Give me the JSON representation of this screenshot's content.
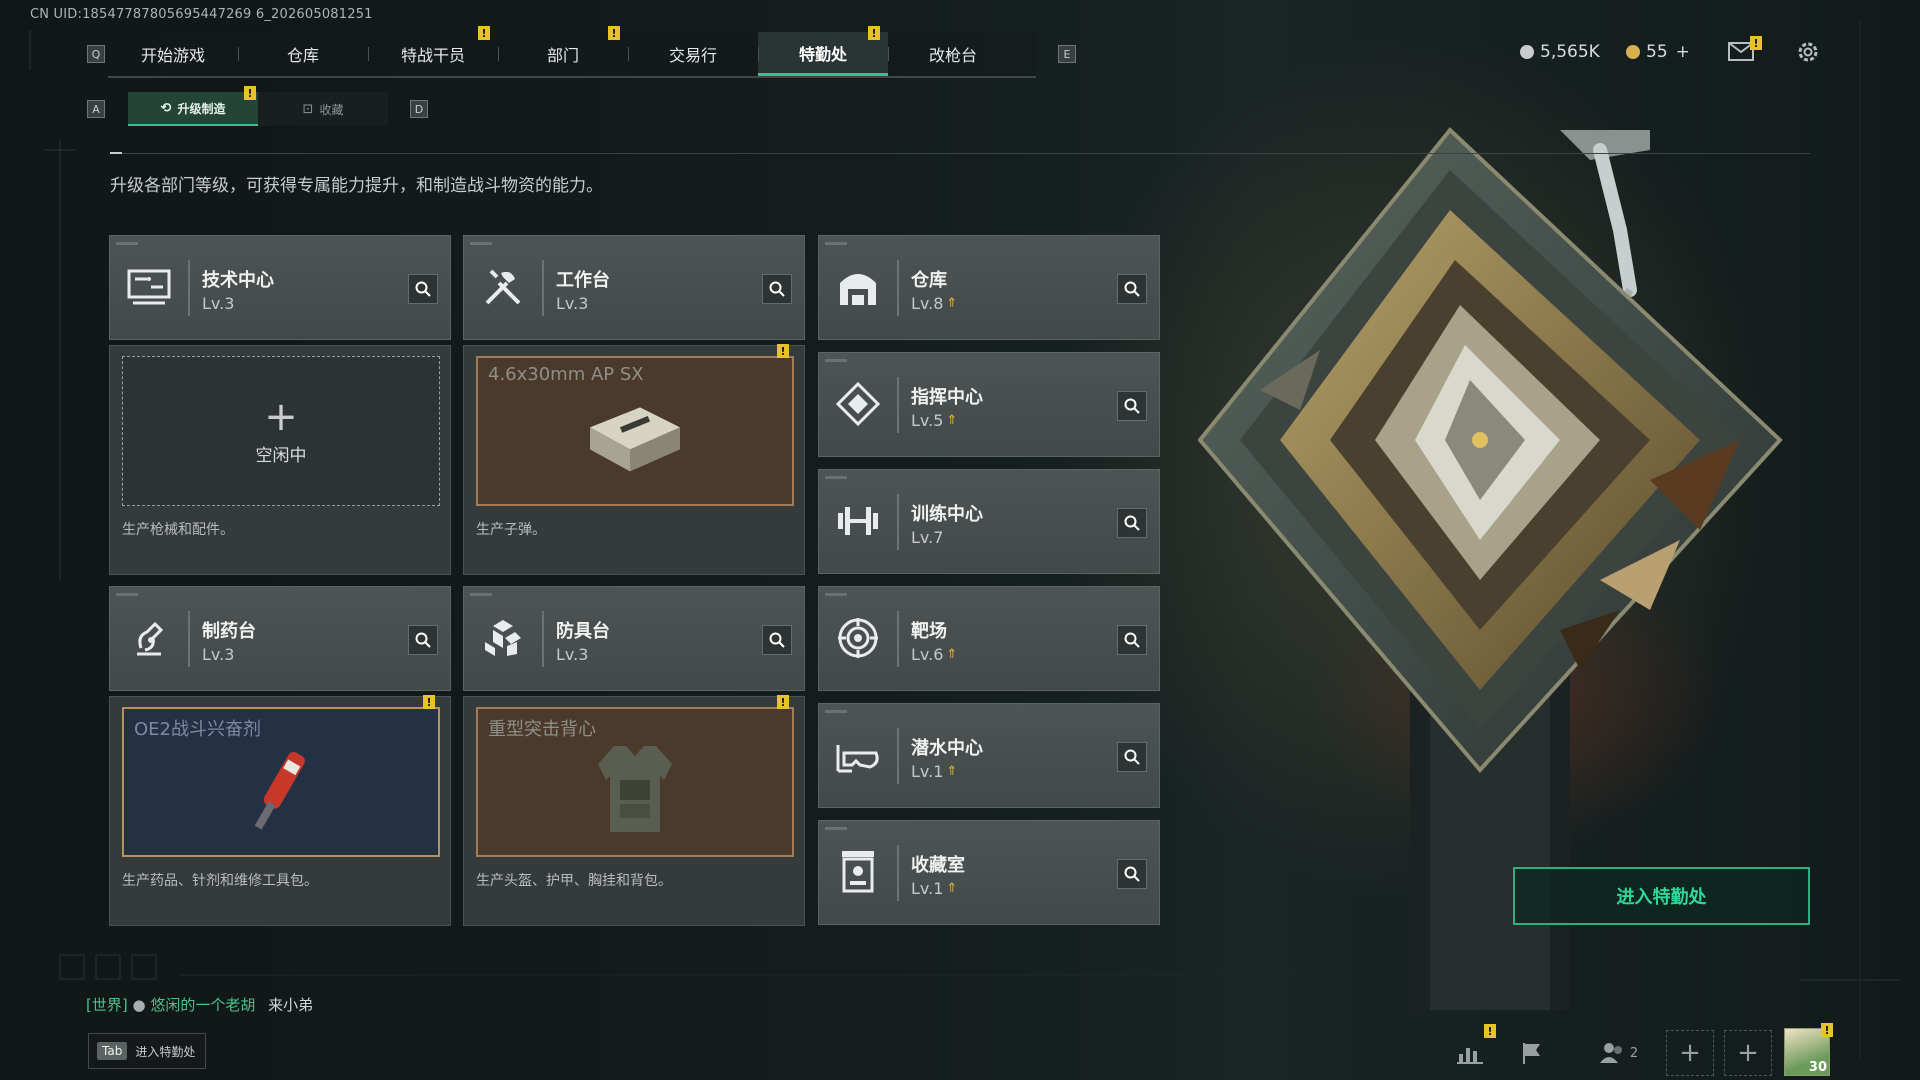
{
  "uid": "CN UID:18547787805695447269 6_202605081251",
  "nav": {
    "left_key": "Q",
    "right_key": "E",
    "tabs": [
      {
        "label": "开始游戏"
      },
      {
        "label": "仓库"
      },
      {
        "label": "特战干员",
        "badge": "!"
      },
      {
        "label": "部门",
        "badge": "!"
      },
      {
        "label": "交易行"
      },
      {
        "label": "特勤处",
        "badge": "!",
        "active": true
      },
      {
        "label": "改枪台"
      }
    ]
  },
  "currency": {
    "silver": "5,565K",
    "gold": "55",
    "plus": "+"
  },
  "subnav": {
    "left_key": "A",
    "right_key": "D",
    "tabs": [
      {
        "label": "升级制造",
        "icon": "upgrade-icon",
        "active": true,
        "badge": "!"
      },
      {
        "label": "收藏",
        "icon": "collection-icon"
      }
    ]
  },
  "description": "升级各部门等级，可获得专属能力提升，和制造战斗物资的能力。",
  "departments": [
    {
      "name": "技术中心",
      "level": "Lv.3",
      "icon": "tech-center-icon",
      "upgradable": false
    },
    {
      "name": "工作台",
      "level": "Lv.3",
      "icon": "workbench-icon",
      "upgradable": false
    },
    {
      "name": "仓库",
      "level": "Lv.8",
      "icon": "warehouse-icon",
      "upgradable": true
    },
    {
      "name": "指挥中心",
      "level": "Lv.5",
      "icon": "command-center-icon",
      "upgradable": true
    },
    {
      "name": "训练中心",
      "level": "Lv.7",
      "icon": "training-center-icon",
      "upgradable": false
    },
    {
      "name": "制药台",
      "level": "Lv.3",
      "icon": "pharmacy-icon",
      "upgradable": false
    },
    {
      "name": "防具台",
      "level": "Lv.3",
      "icon": "armor-bench-icon",
      "upgradable": false
    },
    {
      "name": "靶场",
      "level": "Lv.6",
      "icon": "shooting-range-icon",
      "upgradable": true
    },
    {
      "name": "潜水中心",
      "level": "Lv.1",
      "icon": "diving-center-icon",
      "upgradable": true
    },
    {
      "name": "收藏室",
      "level": "Lv.1",
      "icon": "collection-room-icon",
      "upgradable": true
    }
  ],
  "production": [
    {
      "state": "idle",
      "idle_label": "空闲中",
      "plus": "+",
      "description": "生产枪械和配件。"
    },
    {
      "state": "producing",
      "item": "4.6x30mm AP SX",
      "description": "生产子弹。",
      "badge": "!",
      "color": "brown"
    },
    {
      "state": "producing",
      "item": "OE2战斗兴奋剂",
      "description": "生产药品、针剂和维修工具包。",
      "badge": "!",
      "color": "blue"
    },
    {
      "state": "producing",
      "item": "重型突击背心",
      "description": "生产头盔、护甲、胸挂和背包。",
      "badge": "!",
      "color": "brown"
    }
  ],
  "enter_button": "进入特勤处",
  "chat": {
    "channel": "[世界]",
    "nickname": "悠闲的一个老胡",
    "message": "来小弟"
  },
  "tab_hint": {
    "key": "Tab",
    "label": "进入特勤处"
  },
  "toolbar": {
    "friends_count": "2",
    "avatar_level": "30",
    "plus": "+"
  },
  "colors": {
    "accent_green": "#36c38f",
    "badge_yellow": "#e8c22a",
    "upgrade_gold": "#e8b83a"
  }
}
